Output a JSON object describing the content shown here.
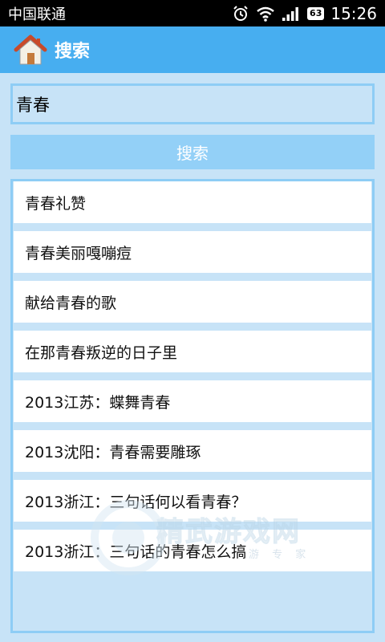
{
  "status_bar": {
    "carrier": "中国联通",
    "battery": "63",
    "time": "15:26",
    "icons": [
      "alarm-icon",
      "wifi-icon",
      "signal-icon",
      "battery-icon"
    ]
  },
  "header": {
    "icon": "home-icon",
    "title": "搜索"
  },
  "search": {
    "value": "青春",
    "placeholder": "",
    "button_label": "搜索"
  },
  "results": [
    {
      "label": "青春礼赞"
    },
    {
      "label": "青春美丽嘎嘣痘"
    },
    {
      "label": "献给青春的歌"
    },
    {
      "label": "在那青春叛逆的日子里"
    },
    {
      "label": "2013江苏：蝶舞青春"
    },
    {
      "label": "2013沈阳：青春需要雕琢"
    },
    {
      "label": "2013浙江：三句话何以看青春？"
    },
    {
      "label": "2013浙江：三句话的青春怎么搞"
    }
  ],
  "watermark": {
    "main": "精武游戏网",
    "sub": "游 专 家"
  },
  "colors": {
    "title_bar": "#47aef0",
    "background": "#c7e3f7",
    "border": "#8ecdf5",
    "button": "#93d0f7"
  }
}
